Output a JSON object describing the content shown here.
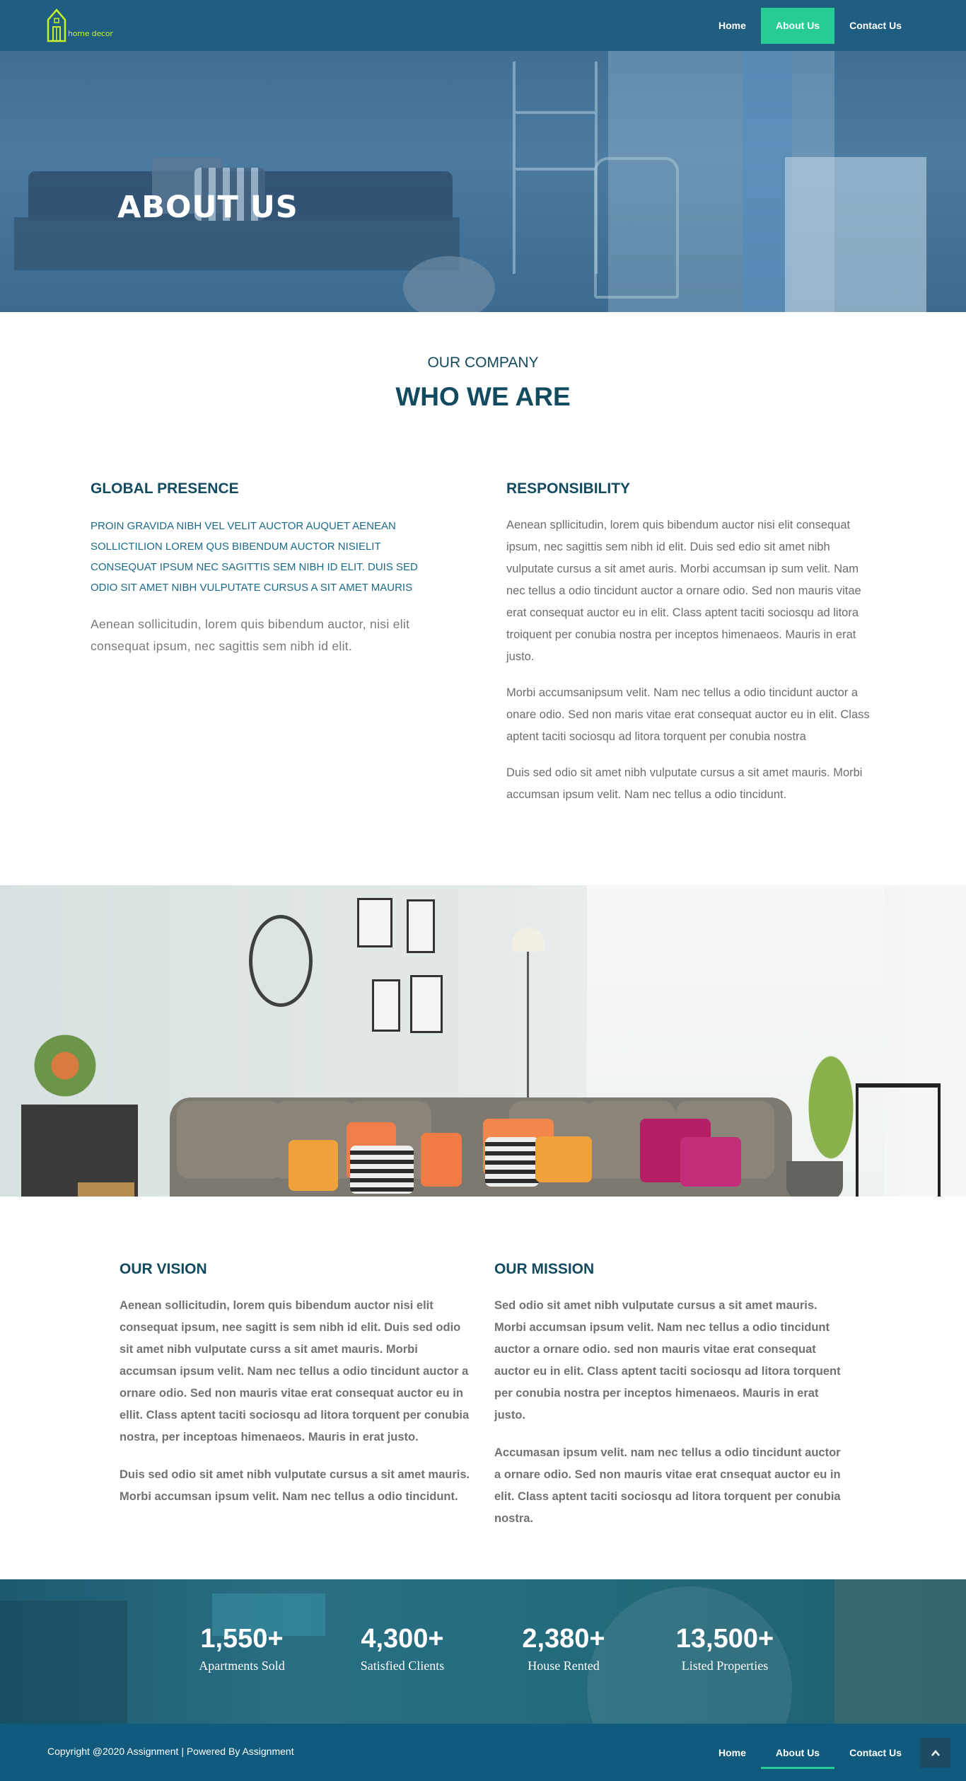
{
  "header": {
    "logo_text": "home decor",
    "nav": [
      {
        "label": "Home",
        "active": false
      },
      {
        "label": "About Us",
        "active": true
      },
      {
        "label": "Contact Us",
        "active": false
      }
    ]
  },
  "hero": {
    "title": "ABOUT US"
  },
  "company": {
    "subtitle": "OUR COMPANY",
    "title": "WHO WE ARE"
  },
  "global_presence": {
    "heading": "GLOBAL PRESENCE",
    "uppercase_text": "PROIN GRAVIDA NIBH VEL VELIT AUCTOR AUQUET AENEAN SOLLICTILION LOREM QUS BIBENDUM AUCTOR NISIELIT CONSEQUAT IPSUM NEC SAGITTIS SEM NIBH ID ELIT. DUIS SED ODIO SIT AMET NIBH VULPUTATE CURSUS A SIT AMET MAURIS",
    "paragraph": "Aenean sollicitudin, lorem quis bibendum auctor, nisi elit consequat ipsum, nec sagittis sem nibh id elit."
  },
  "responsibility": {
    "heading": "RESPONSIBILITY",
    "paragraphs": [
      "Aenean spllicitudin, lorem quis  bibendum auctor nisi elit consequat ipsum, nec sagittis sem nibh id elit. Duis sed edio sit amet nibh vulputate cursus a sit amet auris. Morbi accumsan ip sum velit. Nam nec tellus a odio tincidunt auctor a ornare odio. Sed non mauris vitae erat consequat auctor eu in elit. Class aptent taciti sociosqu ad litora troiquent per conubia nostra per inceptos himenaeos. Mauris in erat justo.",
      "Morbi accumsanipsum velit. Nam nec tellus a odio tincidunt auctor a onare odio. Sed non maris vitae erat consequat auctor eu in elit. Class aptent taciti sociosqu ad litora  torquent per conubia nostra",
      "Duis sed odio sit amet nibh vulputate cursus a sit amet mauris. Morbi accumsan ipsum velit. Nam nec tellus a odio tincidunt."
    ]
  },
  "vision": {
    "heading": "OUR VISION",
    "paragraphs": [
      "Aenean sollicitudin, lorem quis bibendum auctor nisi elit consequat ipsum, nee sagitt is sem nibh id elit. Duis sed odio sit amet nibh vulputate curss a sit amet mauris. Morbi accumsan ipsum velit. Nam nec tellus a odio tincidunt auctor a ornare odio. Sed non mauris vitae erat consequat auctor eu in ellit. Class aptent taciti sociosqu ad litora torquent per conubia nostra, per inceptoas himenaeos. Mauris in erat justo.",
      "Duis sed odio sit amet nibh vulputate cursus a sit amet mauris. Morbi accumsan ipsum velit. Nam nec tellus a odio tincidunt."
    ]
  },
  "mission": {
    "heading": "OUR MISSION",
    "paragraphs": [
      "Sed odio sit amet nibh vulputate cursus a sit amet mauris. Morbi accumsan ipsum velit. Nam nec tellus a odio tincidunt auctor a ornare odio. sed non mauris vitae erat consequat auctor eu in elit. Class aptent taciti sociosqu ad litora torquent per conubia nostra per inceptos himenaeos. Mauris in erat justo.",
      "Accumasan ipsum velit. nam nec tellus a odio tincidunt auctor a ornare odio. Sed non mauris vitae erat cnsequat auctor eu in elit. Class aptent taciti sociosqu ad litora torquent per conubia nostra."
    ]
  },
  "stats": [
    {
      "number": "1,550+",
      "label": "Apartments Sold"
    },
    {
      "number": "4,300+",
      "label": "Satisfied Clients"
    },
    {
      "number": "2,380+",
      "label": "House Rented"
    },
    {
      "number": "13,500+",
      "label": "Listed Properties"
    }
  ],
  "footer": {
    "copyright": "Copyright @2020 Assignment | Powered By Assignment",
    "nav": [
      {
        "label": "Home",
        "active": false
      },
      {
        "label": "About Us",
        "active": true
      },
      {
        "label": "Contact Us",
        "active": false
      }
    ],
    "back_to_top_icon": "chevron-up-icon"
  },
  "colors": {
    "header_bg": "#1f5e80",
    "accent": "#26cc93",
    "heading": "#124a5f",
    "footer_bg": "#0f5a7d"
  }
}
